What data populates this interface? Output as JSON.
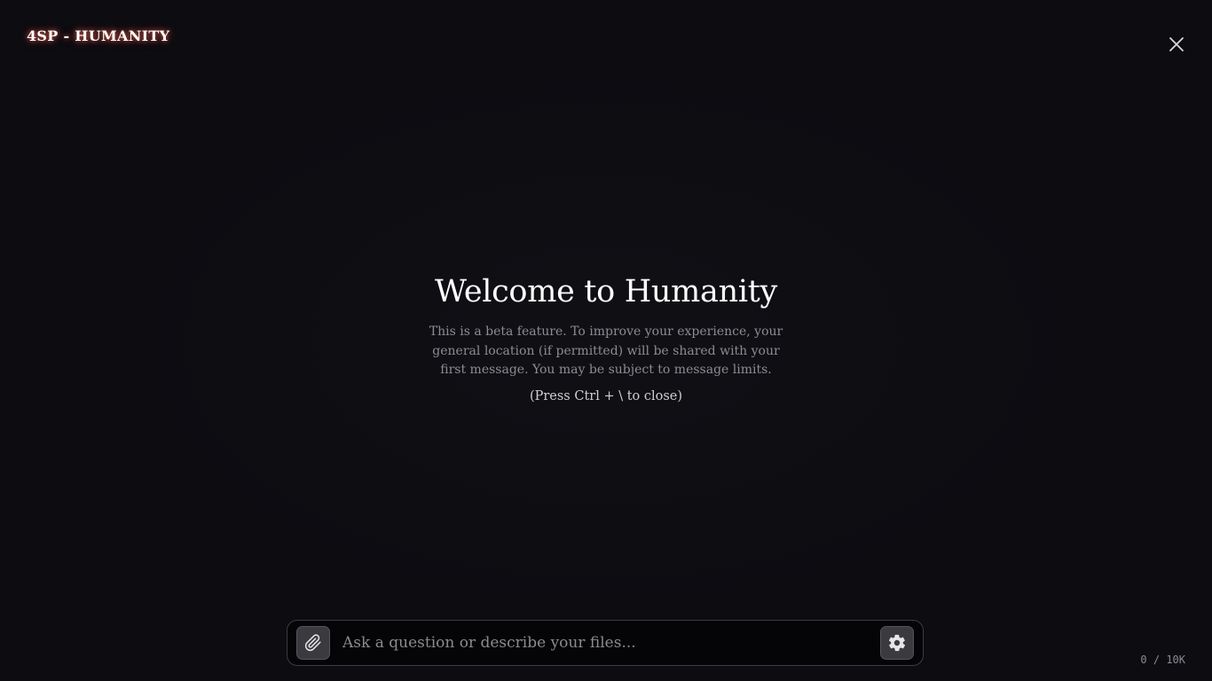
{
  "header": {
    "app_title": "4SP - HUMANITY",
    "close_icon": "close-icon"
  },
  "welcome": {
    "title": "Welcome to Humanity",
    "description": "This is a beta feature. To improve your experience, your general location (if permitted) will be shared with your first message. You may be subject to message limits.",
    "hint": "(Press Ctrl + \\ to close)"
  },
  "composer": {
    "attach_icon": "paperclip-icon",
    "input_value": "",
    "input_placeholder": "Ask a question or describe your files...",
    "settings_icon": "gear-icon"
  },
  "footer": {
    "char_counter": "0 / 10K"
  },
  "colors": {
    "background": "#0c0c11",
    "title_glow": "#ff6e5a",
    "button_bg": "#3a3a3f"
  }
}
